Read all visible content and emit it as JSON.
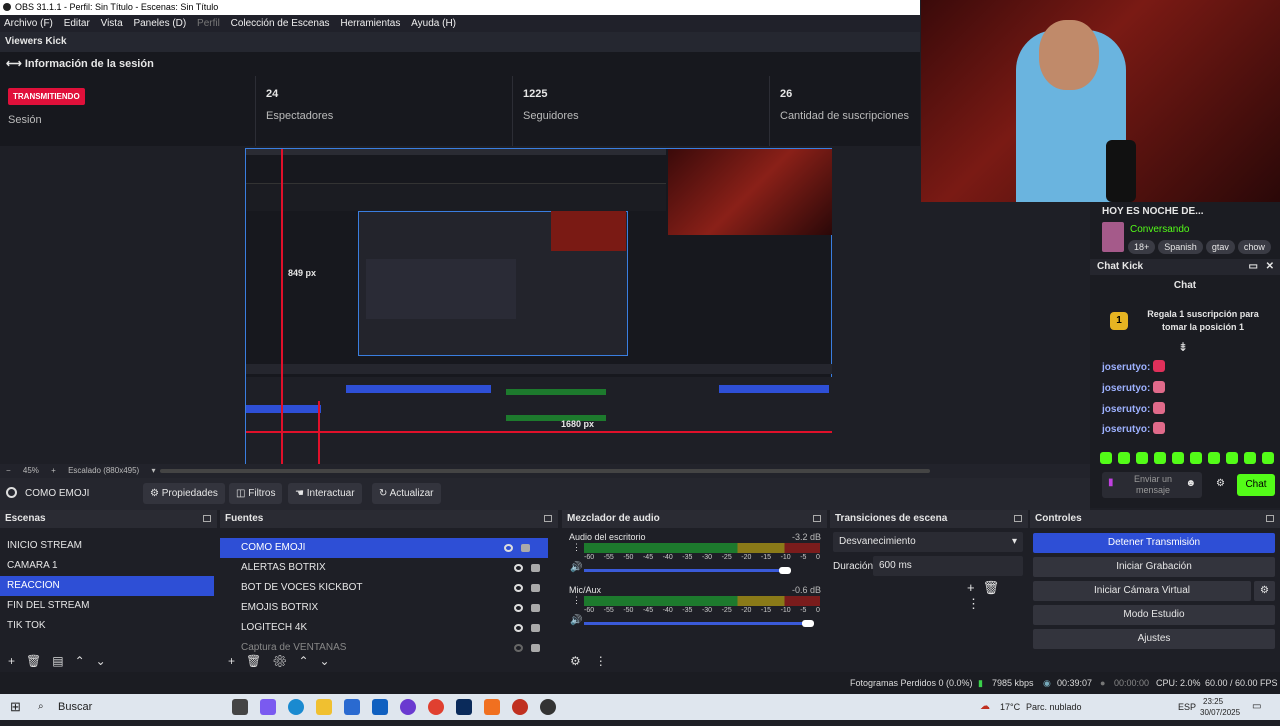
{
  "window": {
    "title": "OBS 31.1.1 - Perfil: Sin Título - Escenas: Sin Título"
  },
  "menu": {
    "items": [
      "Archivo (F)",
      "Editar",
      "Vista",
      "Paneles (D)",
      "Perfil",
      "Colección de Escenas",
      "Herramientas",
      "Ayuda (H)"
    ]
  },
  "dock": {
    "title": "Viewers Kick",
    "section": "Información de la sesión"
  },
  "stats": {
    "status_badge": "TRANSMITIENDO",
    "session_label": "Sesión",
    "viewers": "24",
    "viewers_label": "Espectadores",
    "followers": "1225",
    "followers_label": "Seguidores",
    "subs": "26",
    "subs_label": "Cantidad de suscripciones"
  },
  "preview": {
    "measure_v": "849 px",
    "measure_h": "1680 px"
  },
  "zoom": {
    "minus": "−",
    "value": "45%",
    "plus": "+",
    "mode": "Escalado (880x495)"
  },
  "source_toolbar": {
    "current": "COMO EMOJI",
    "properties": "Propiedades",
    "filters": "Filtros",
    "interact": "Interactuar",
    "refresh": "Actualizar"
  },
  "scenes": {
    "title": "Escenas",
    "items": [
      "INICIO STREAM",
      "CAMARA 1",
      "REACCION",
      "FIN DEL STREAM",
      "TIK TOK"
    ],
    "selected": 2
  },
  "sources": {
    "title": "Fuentes",
    "items": [
      "COMO EMOJI",
      "ALERTAS BOTRIX",
      "BOT DE VOCES KICKBOT",
      "EMOJIS BOTRIX",
      "LOGITECH 4K",
      "Captura de VENTANAS"
    ],
    "selected": 0
  },
  "mixer": {
    "title": "Mezclador de audio",
    "ch1": {
      "name": "Audio del escritorio",
      "db": "-3.2 dB",
      "level": 0.85
    },
    "ch2": {
      "name": "Mic/Aux",
      "db": "-0.6 dB",
      "level": 0.95
    },
    "scale": [
      "-60",
      "-55",
      "-50",
      "-45",
      "-40",
      "-35",
      "-30",
      "-25",
      "-20",
      "-15",
      "-10",
      "-5",
      "0"
    ]
  },
  "transitions": {
    "title": "Transiciones de escena",
    "selected": "Desvanecimiento",
    "duration_label": "Duración",
    "duration": "600 ms"
  },
  "controls": {
    "title": "Controles",
    "buttons": [
      "Detener Transmisión",
      "Iniciar Grabación",
      "Iniciar Cámara Virtual",
      "Modo Estudio",
      "Ajustes"
    ]
  },
  "status": {
    "dropped": "Fotogramas Perdidos 0 (0.0%)",
    "bitrate": "7985 kbps",
    "live_time": "00:39:07",
    "rec_time": "00:00:00",
    "cpu": "CPU: 2.0%",
    "fps": "60.00 / 60.00 FPS"
  },
  "stream_info": {
    "title": "HOY ES NOCHE DE...",
    "category": "Conversando",
    "tags": [
      "18+",
      "Spanish",
      "gtav",
      "chow"
    ]
  },
  "chat": {
    "dock_title": "Chat Kick",
    "title": "Chat",
    "pinned": "Regala 1 suscripción para tomar la posición 1",
    "user": "joserutyo:",
    "input_placeholder": "Enviar un mensaje",
    "send": "Chat"
  },
  "taskbar": {
    "search": "Buscar",
    "weather": "17°C",
    "weather_desc": "Parc. nublado",
    "lang": "ESP",
    "time": "23:25",
    "date": "30/07/2025"
  },
  "colors": {
    "accent": "#2e4fd6",
    "live": "#e0103a",
    "kick_green": "#53fc18"
  }
}
